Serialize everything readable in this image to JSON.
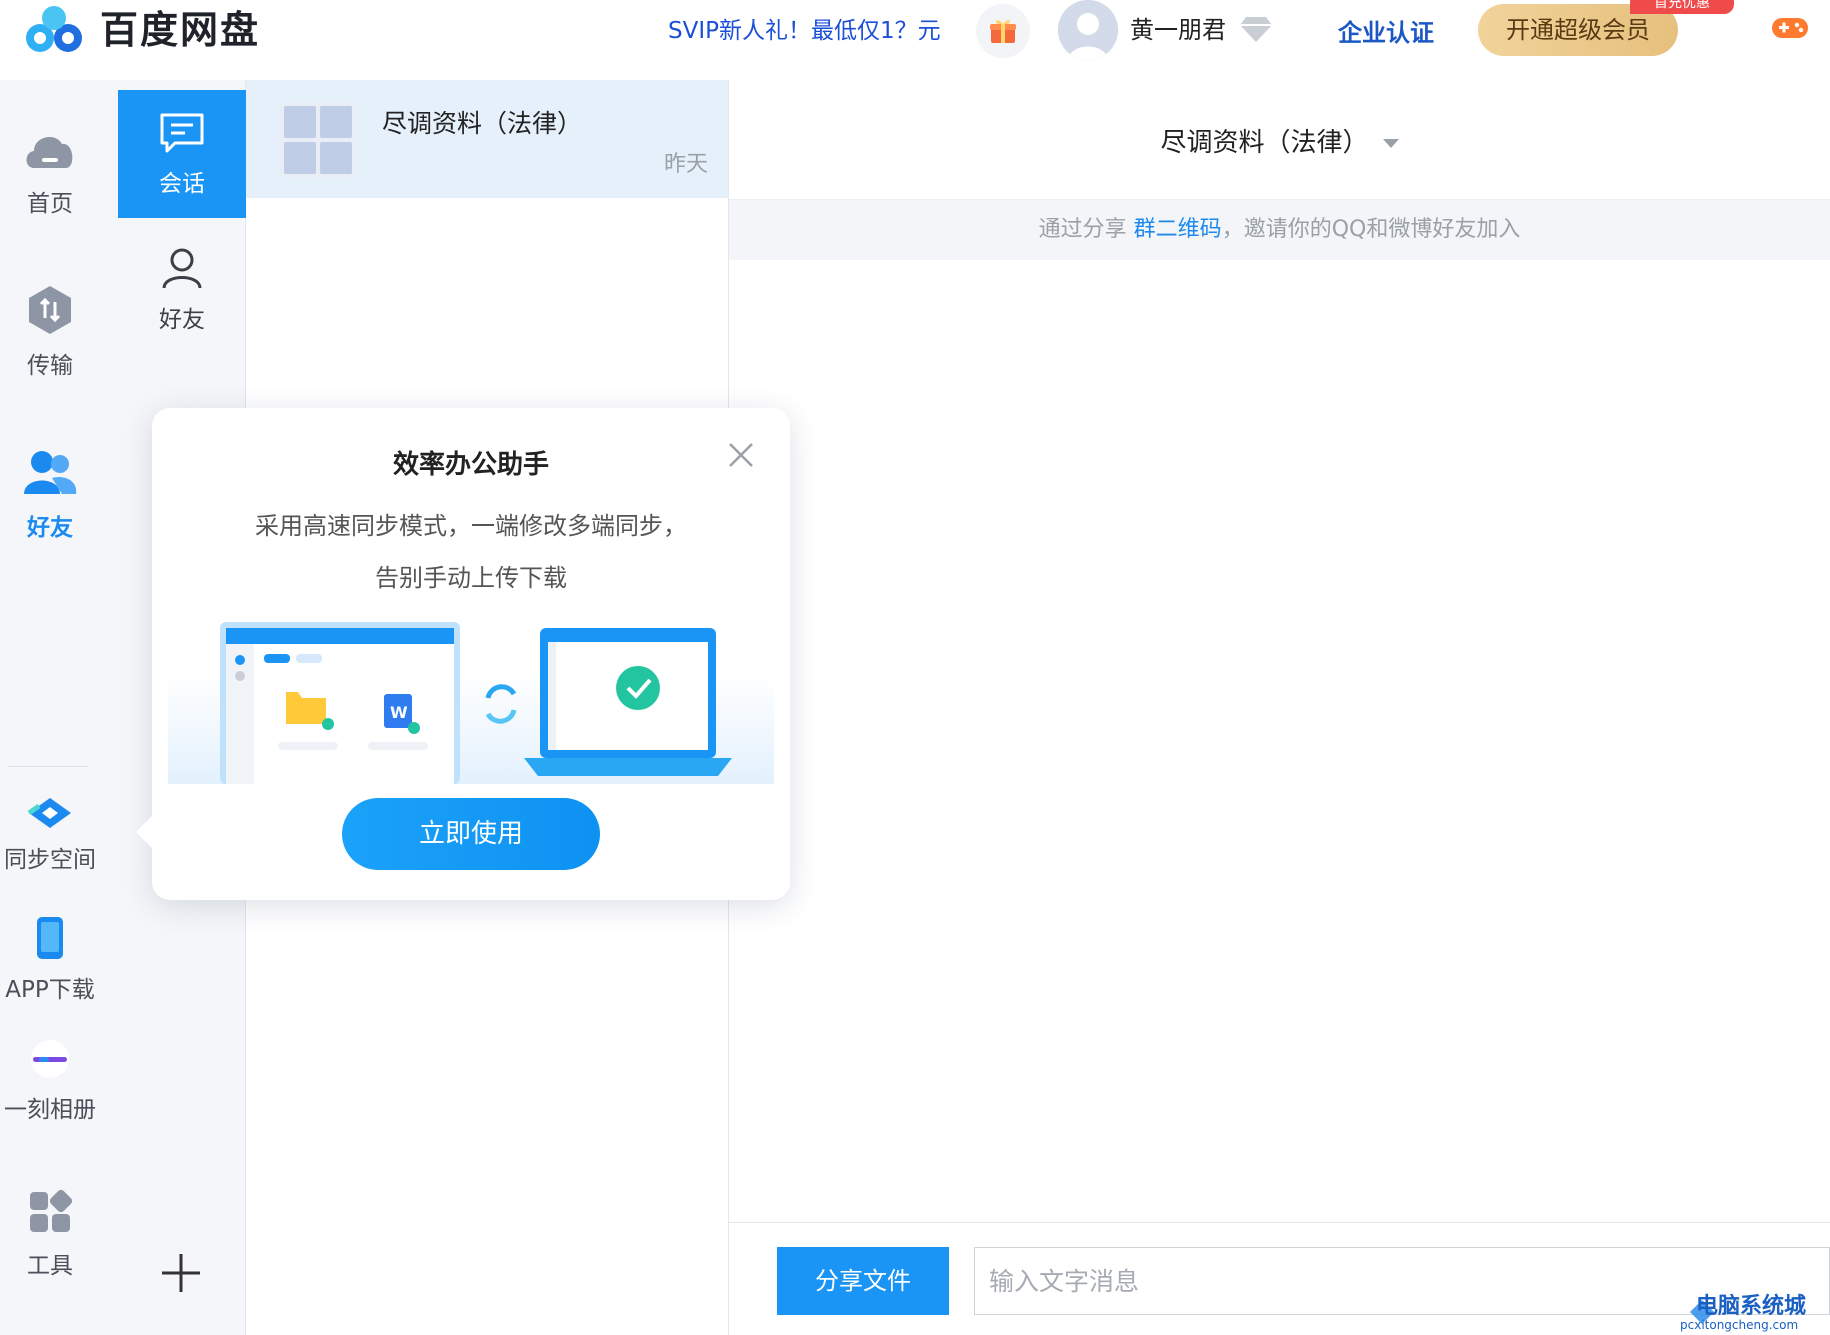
{
  "header": {
    "app_title": "百度网盘",
    "promo_link": "SVIP新人礼！最低仅1？元",
    "username": "黄一朋君",
    "enterprise_link": "企业认证",
    "vip_button": "开通超级会员",
    "vip_badge": "首充优惠"
  },
  "nav": {
    "items": [
      {
        "label": "首页",
        "icon": "cloud-icon"
      },
      {
        "label": "传输",
        "icon": "transfer-icon"
      },
      {
        "label": "好友",
        "icon": "friends-icon",
        "active": true
      },
      {
        "label": "同步空间",
        "icon": "sync-space-icon"
      },
      {
        "label": "APP下载",
        "icon": "phone-icon"
      },
      {
        "label": "一刻相册",
        "icon": "album-icon"
      },
      {
        "label": "工具",
        "icon": "tools-icon"
      }
    ]
  },
  "subnav": {
    "items": [
      {
        "label": "会话",
        "icon": "chat-icon",
        "active": true
      },
      {
        "label": "好友",
        "icon": "person-icon"
      }
    ]
  },
  "conversations": [
    {
      "name": "尽调资料（法律）",
      "time": "昨天"
    }
  ],
  "chat": {
    "title": "尽调资料（法律）",
    "invite_prefix": "通过分享",
    "invite_link": "群二维码",
    "invite_suffix": "，邀请你的QQ和微博好友加入",
    "share_file_button": "分享文件",
    "message_placeholder": "输入文字消息"
  },
  "popup": {
    "title": "效率办公助手",
    "desc_line1": "采用高速同步模式，一端修改多端同步，",
    "desc_line2": "告别手动上传下载",
    "button": "立即使用"
  },
  "watermark": {
    "text": "电脑系统城",
    "sub": "pcxitongcheng.com"
  },
  "colors": {
    "accent": "#1b95f5",
    "vip_gold": "#e6c07d",
    "nav_bg": "#f5f6f9",
    "selected_row": "#e6f0fb"
  }
}
